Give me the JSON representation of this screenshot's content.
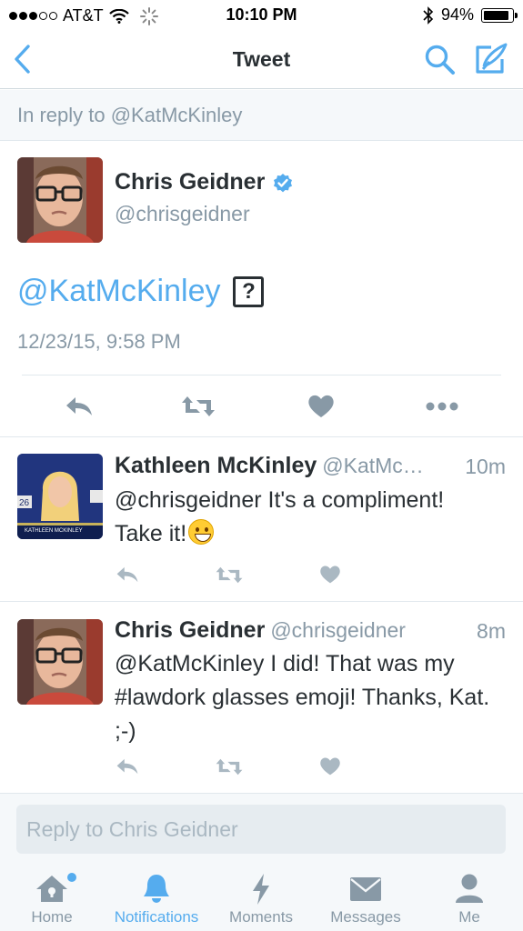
{
  "status_bar": {
    "carrier": "AT&T",
    "time": "10:10 PM",
    "battery_percent": "94%",
    "battery_level": 0.94,
    "signal_bars_filled": 3,
    "signal_bars_total": 5
  },
  "nav": {
    "title": "Tweet",
    "back_icon": "chevron-left-icon",
    "search_icon": "search-icon",
    "compose_icon": "compose-icon"
  },
  "context": {
    "text": "In reply to @KatMcKinley"
  },
  "main_tweet": {
    "name": "Chris Geidner",
    "verified": true,
    "handle": "@chrisgeidner",
    "body": "@KatMcKinley",
    "unsupported_glyph": "?",
    "timestamp": "12/23/15, 9:58 PM",
    "actions": [
      "reply-icon",
      "retweet-icon",
      "like-icon",
      "more-icon"
    ]
  },
  "replies": [
    {
      "name": "Kathleen McKinley",
      "handle": "@KatMc…",
      "time": "10m",
      "text_line1": "@chrisgeidner It's a compliment!",
      "text_line2": "Take it!",
      "emoji": "grinning-face-emoji",
      "avatar_caption": "KATHLEEN MCKINLEY"
    },
    {
      "name": "Chris Geidner",
      "handle": "@chrisgeidner",
      "time": "8m",
      "text": "@KatMcKinley I did! That was my #lawdork glasses emoji! Thanks, Kat. ;-)"
    }
  ],
  "reply_box": {
    "placeholder": "Reply to Chris Geidner"
  },
  "tabs": [
    {
      "label": "Home",
      "icon": "home-icon",
      "active": false,
      "has_dot": true
    },
    {
      "label": "Notifications",
      "icon": "bell-icon",
      "active": true,
      "has_dot": false
    },
    {
      "label": "Moments",
      "icon": "lightning-icon",
      "active": false,
      "has_dot": false
    },
    {
      "label": "Messages",
      "icon": "envelope-icon",
      "active": false,
      "has_dot": false
    },
    {
      "label": "Me",
      "icon": "person-icon",
      "active": false,
      "has_dot": false
    }
  ],
  "colors": {
    "accent": "#55acee",
    "text": "#292f33",
    "muted": "#8899a6",
    "separator": "#e1e8ed",
    "background_alt": "#f5f8fa",
    "action_icon": "#aab8c2"
  }
}
